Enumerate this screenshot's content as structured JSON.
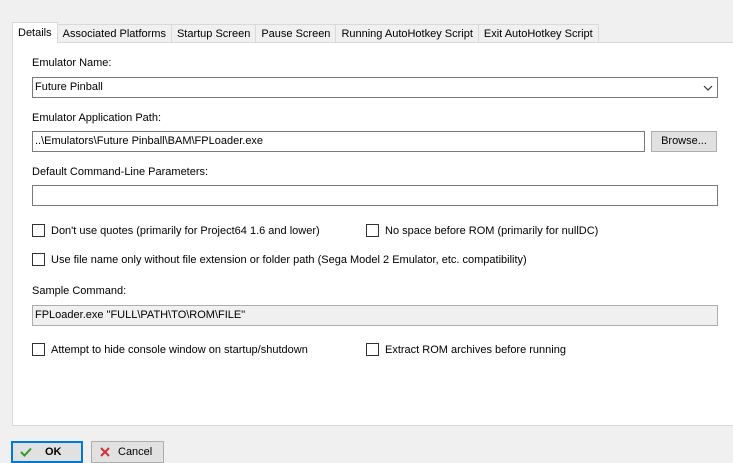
{
  "tabs": [
    {
      "label": "Details",
      "active": true
    },
    {
      "label": "Associated Platforms",
      "active": false
    },
    {
      "label": "Startup Screen",
      "active": false
    },
    {
      "label": "Pause Screen",
      "active": false
    },
    {
      "label": "Running AutoHotkey Script",
      "active": false
    },
    {
      "label": "Exit AutoHotkey Script",
      "active": false
    }
  ],
  "details": {
    "emulator_name_label": "Emulator Name:",
    "emulator_name_value": "Future Pinball",
    "app_path_label": "Emulator Application Path:",
    "app_path_value": "..\\Emulators\\Future Pinball\\BAM\\FPLoader.exe",
    "browse_label": "Browse...",
    "params_label": "Default Command-Line Parameters:",
    "params_value": "",
    "options": {
      "no_quotes": {
        "label": "Don't use quotes (primarily for Project64 1.6 and lower)",
        "checked": false
      },
      "no_space": {
        "label": "No space before ROM (primarily for nullDC)",
        "checked": false
      },
      "file_name_only": {
        "label": "Use file name only without file extension or folder path (Sega Model 2 Emulator, etc. compatibility)",
        "checked": false
      },
      "hide_console": {
        "label": "Attempt to hide console window on startup/shutdown",
        "checked": false
      },
      "extract_rom": {
        "label": "Extract ROM archives before running",
        "checked": false
      }
    },
    "sample_label": "Sample Command:",
    "sample_value": "FPLoader.exe \"FULL\\PATH\\TO\\ROM\\FILE\""
  },
  "footer": {
    "ok_label": "OK",
    "cancel_label": "Cancel"
  },
  "colors": {
    "focus": "#0078d7",
    "ok_check": "#2e9a2e",
    "cancel_x": "#d13438"
  },
  "icons": {
    "ok": "checkmark-icon",
    "cancel": "x-icon",
    "dropdown": "chevron-down-icon"
  }
}
